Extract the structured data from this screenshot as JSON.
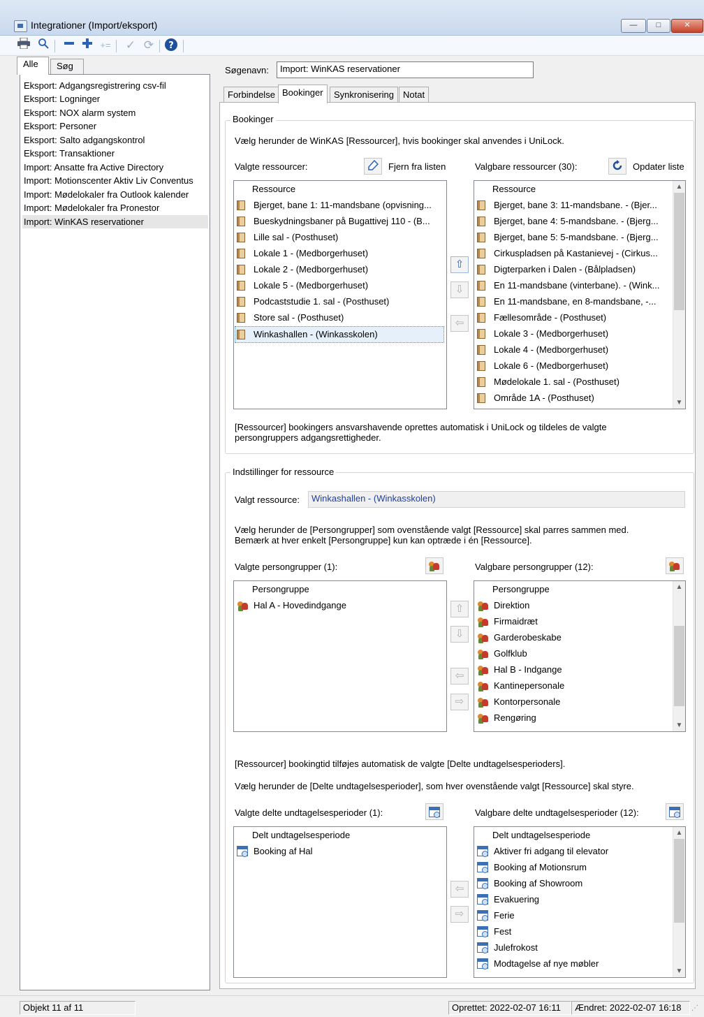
{
  "window": {
    "title": "Integrationer  (Import/eksport)",
    "min": "—",
    "max": "□",
    "close": "✕"
  },
  "left_tabs": [
    "Alle",
    "Søg"
  ],
  "left_items": [
    "Eksport: Adgangsregistrering csv-fil",
    "Eksport: Logninger",
    "Eksport: NOX alarm system",
    "Eksport: Personer",
    "Eksport: Salto adgangskontrol",
    "Eksport: Transaktioner",
    "Import: Ansatte fra Active Directory",
    "Import: Motionscenter Aktiv Liv Conventus",
    "Import: Mødelokaler fra Outlook kalender",
    "Import: Mødelokaler fra Pronestor",
    "Import: WinKAS reservationer"
  ],
  "search_name": {
    "label": "Søgenavn:",
    "value": "Import: WinKAS reservationer"
  },
  "tabs": [
    "Forbindelse",
    "Bookinger",
    "Synkronisering",
    "Notat"
  ],
  "bookings": {
    "group_title": "Bookinger",
    "intro": "Vælg herunder de WinKAS [Ressourcer], hvis bookinger skal anvendes i UniLock.",
    "selected_label": "Valgte ressourcer:",
    "remove_label": "Fjern fra listen",
    "available_label": "Valgbare ressourcer (30):",
    "refresh_label": "Opdater liste",
    "col_header": "Ressource",
    "selected": [
      "Bjerget, bane 1: 11-mandsbane (opvisning...",
      "Bueskydningsbaner på Bugattivej 110 - (B...",
      "Lille sal - (Posthuset)",
      "Lokale 1 - (Medborgerhuset)",
      "Lokale 2 - (Medborgerhuset)",
      "Lokale 5 - (Medborgerhuset)",
      "Podcaststudie 1. sal - (Posthuset)",
      "Store sal - (Posthuset)",
      "Winkashallen - (Winkasskolen)"
    ],
    "available": [
      "Bjerget, bane 3: 11-mandsbane. - (Bjer...",
      "Bjerget, bane 4: 5-mandsbane. - (Bjerg...",
      "Bjerget, bane 5: 5-mandsbane. - (Bjerg...",
      "Cirkuspladsen på Kastanievej - (Cirkus...",
      "Digterparken i Dalen - (Bålpladsen)",
      "En 11-mandsbane (vinterbane). - (Wink...",
      "En 11-mandsbane, en 8-mandsbane,  -...",
      "Fællesområde - (Posthuset)",
      "Lokale 3 - (Medborgerhuset)",
      "Lokale 4 - (Medborgerhuset)",
      "Lokale 6 - (Medborgerhuset)",
      "Mødelokale 1. sal - (Posthuset)",
      "Område 1A - (Posthuset)"
    ],
    "footer": "[Ressourcer] bookingers ansvarshavende oprettes automatisk i UniLock og tildeles de valgte persongruppers adgangsrettigheder."
  },
  "settings": {
    "group_title": "Indstillinger for ressource",
    "selected_resource_label": "Valgt ressource:",
    "selected_resource_value": "Winkashallen - (Winkasskolen)",
    "intro": "Vælg herunder de [Persongrupper] som ovenstående valgt [Ressource] skal parres sammen med. Bemærk at hver enkelt [Persongruppe] kun kan optræde i én [Ressource].",
    "pg_selected_label": "Valgte persongrupper (1):",
    "pg_available_label": "Valgbare persongrupper (12):",
    "pg_header": "Persongruppe",
    "pg_selected": [
      "Hal A - Hovedindgange"
    ],
    "pg_available": [
      "Direktion",
      "Firmaidræt",
      "Garderobeskabe",
      "Golfklub",
      "Hal B - Indgange",
      "Kantinepersonale",
      "Kontorpersonale",
      "Rengøring"
    ],
    "text1": "[Ressourcer] bookingtid tilføjes automatisk de valgte [Delte undtagelsesperioders].",
    "text2": "Vælg herunder de [Delte undtagelsesperioder], som hver ovenstående valgt [Ressource] skal styre.",
    "ex_selected_label": "Valgte delte undtagelsesperioder (1):",
    "ex_available_label": "Valgbare delte undtagelsesperioder (12):",
    "ex_header": "Delt undtagelsesperiode",
    "ex_selected": [
      "Booking af Hal"
    ],
    "ex_available": [
      "Aktiver fri adgang til elevator",
      "Booking af Motionsrum",
      "Booking af Showroom",
      "Evakuering",
      "Ferie",
      "Fest",
      "Julefrokost",
      "Modtagelse af nye møbler"
    ]
  },
  "status": {
    "object": "Objekt 11 af 11",
    "created": "Oprettet: 2022-02-07  16:11",
    "changed": "Ændret: 2022-02-07  16:18"
  },
  "colors": {
    "accent": "#2a62b6",
    "selected_resource_text": "#1f3f9e"
  }
}
